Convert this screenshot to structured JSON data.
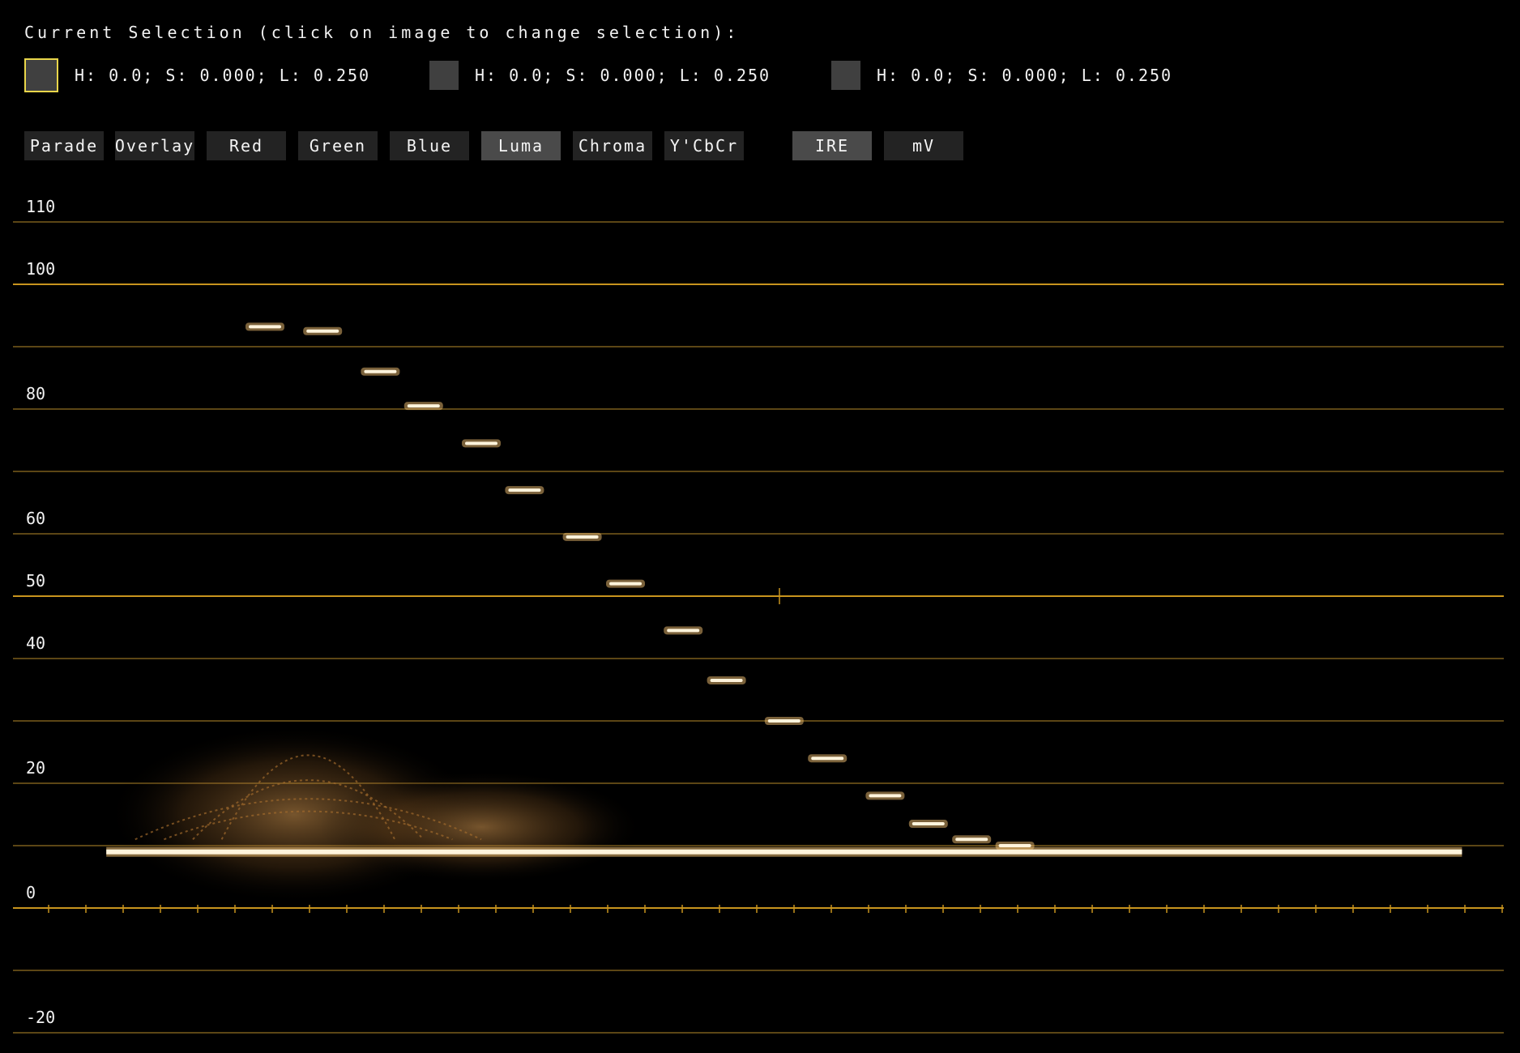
{
  "selection": {
    "title": "Current Selection (click on image to change selection):",
    "swatches": [
      {
        "text": "H: 0.0; S: 0.000; L: 0.250",
        "active": true,
        "color": "#404040"
      },
      {
        "text": "H: 0.0; S: 0.000; L: 0.250",
        "active": false,
        "color": "#404040"
      },
      {
        "text": "H: 0.0; S: 0.000; L: 0.250",
        "active": false,
        "color": "#404040"
      }
    ]
  },
  "mode_buttons": [
    {
      "label": "Parade",
      "active": false
    },
    {
      "label": "Overlay",
      "active": false
    },
    {
      "label": "Red",
      "active": false
    },
    {
      "label": "Green",
      "active": false
    },
    {
      "label": "Blue",
      "active": false
    },
    {
      "label": "Luma",
      "active": true
    },
    {
      "label": "Chroma",
      "active": false
    },
    {
      "label": "Y'CbCr",
      "active": false
    }
  ],
  "unit_buttons": [
    {
      "label": "IRE",
      "active": true
    },
    {
      "label": "mV",
      "active": false
    }
  ],
  "colors": {
    "background": "#000000",
    "major_line": "#c8941e",
    "minor_line": "#7a5d1c",
    "trace": "#f3c173",
    "trace_bright": "#fff4dc",
    "button": "#232323",
    "button_active": "#4a4a4a",
    "swatch_border_active": "#e9d64a"
  },
  "chart_data": {
    "type": "scatter",
    "title": "",
    "xlabel": "",
    "ylabel": "",
    "unit": "IRE",
    "ylim": [
      -20,
      110
    ],
    "y_tick_labels": [
      "110",
      "100",
      "80",
      "60",
      "50",
      "40",
      "20",
      "0",
      "-20"
    ],
    "major_lines": [
      100,
      50,
      0
    ],
    "minor_lines": [
      110,
      90,
      80,
      70,
      60,
      40,
      30,
      20,
      10,
      -10,
      -20
    ],
    "xlim": [
      0,
      1
    ],
    "grid": true,
    "series": [
      {
        "kind": "luma_steps",
        "points": [
          {
            "x": 0.15,
            "y": 93.2
          },
          {
            "x": 0.19,
            "y": 92.5
          },
          {
            "x": 0.23,
            "y": 86.0
          },
          {
            "x": 0.26,
            "y": 80.5
          },
          {
            "x": 0.3,
            "y": 74.5
          },
          {
            "x": 0.33,
            "y": 67.0
          },
          {
            "x": 0.37,
            "y": 59.5
          },
          {
            "x": 0.4,
            "y": 52.0
          },
          {
            "x": 0.44,
            "y": 44.5
          },
          {
            "x": 0.47,
            "y": 36.5
          },
          {
            "x": 0.51,
            "y": 30.0
          },
          {
            "x": 0.54,
            "y": 24.0
          },
          {
            "x": 0.58,
            "y": 18.0
          },
          {
            "x": 0.61,
            "y": 13.5
          },
          {
            "x": 0.64,
            "y": 11.0
          },
          {
            "x": 0.67,
            "y": 10.0
          }
        ]
      },
      {
        "kind": "black_floor",
        "x_range": [
          0.04,
          0.98
        ],
        "y": 9.0
      }
    ]
  }
}
